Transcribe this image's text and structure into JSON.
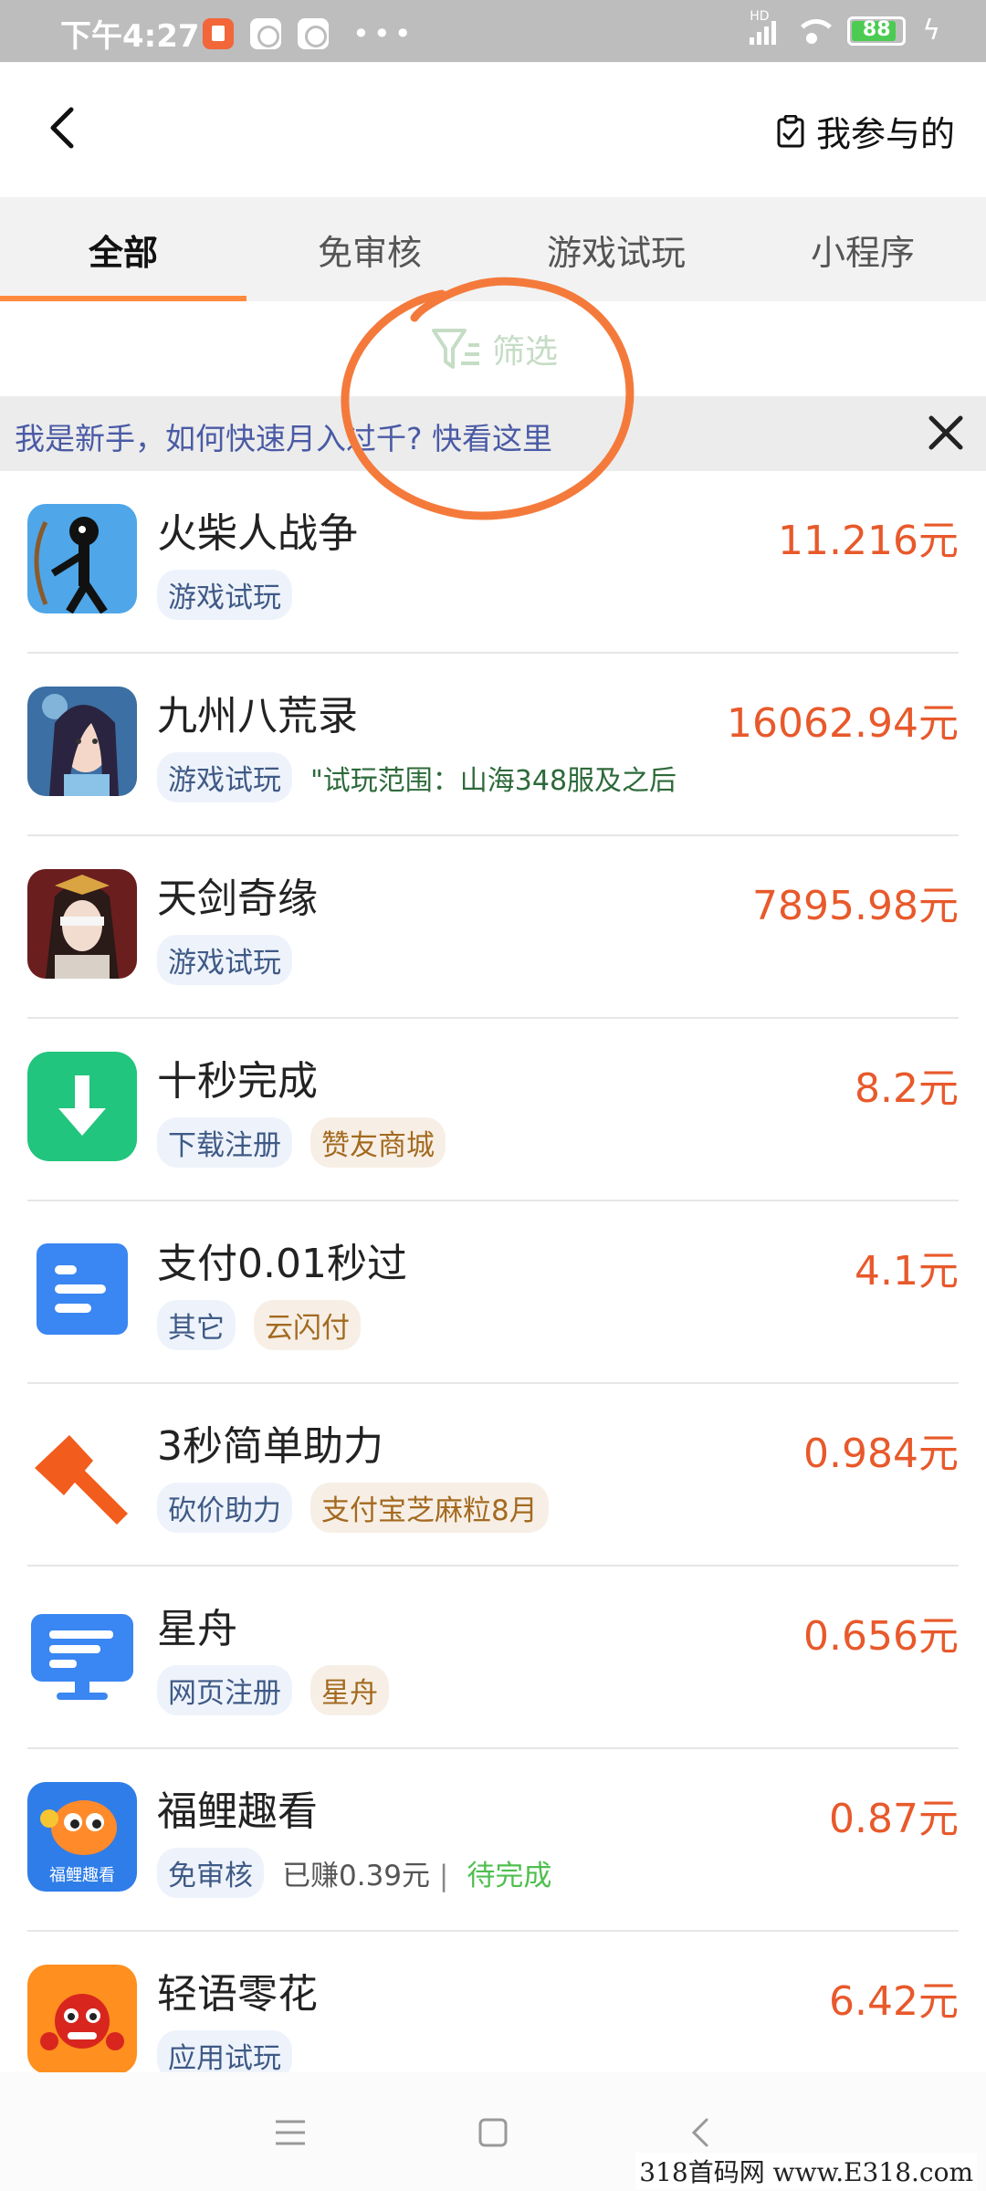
{
  "status_bar": {
    "time": "下午4:27",
    "battery_level": "88",
    "network_badge": "HD"
  },
  "header": {
    "mine_label": "我参与的"
  },
  "tabs": [
    {
      "label": "全部",
      "active": true
    },
    {
      "label": "免审核",
      "active": false
    },
    {
      "label": "游戏试玩",
      "active": false
    },
    {
      "label": "小程序",
      "active": false
    }
  ],
  "filter": {
    "label": "筛选"
  },
  "tip_banner": {
    "text": "我是新手，如何快速月入过千? 快看这里"
  },
  "tasks": [
    {
      "title": "火柴人战争",
      "price": "11.216元",
      "tags": [
        "游戏试玩"
      ],
      "icon": "stickman-bow-icon"
    },
    {
      "title": "九州八荒录",
      "price": "16062.94元",
      "tags": [
        "游戏试玩"
      ],
      "note": "\"试玩范围：山海348服及之后",
      "icon": "fantasy-girl-icon"
    },
    {
      "title": "天剑奇缘",
      "price": "7895.98元",
      "tags": [
        "游戏试玩"
      ],
      "icon": "blindfold-hero-icon"
    },
    {
      "title": "十秒完成",
      "price": "8.2元",
      "tags": [
        "下载注册",
        "赞友商城"
      ],
      "icon": "download-arrow-icon"
    },
    {
      "title": "支付0.01秒过",
      "price": "4.1元",
      "tags": [
        "其它",
        "云闪付"
      ],
      "icon": "document-lines-icon"
    },
    {
      "title": "3秒简单助力",
      "price": "0.984元",
      "tags": [
        "砍价助力",
        "支付宝芝麻粒8月"
      ],
      "icon": "axe-icon"
    },
    {
      "title": "星舟",
      "price": "0.656元",
      "tags": [
        "网页注册",
        "星舟"
      ],
      "icon": "monitor-icon"
    },
    {
      "title": "福鲤趣看",
      "price": "0.87元",
      "tags": [
        "免审核"
      ],
      "earned": "已赚0.39元",
      "separator": "|",
      "status": "待完成",
      "icon": "lucky-fish-icon",
      "icon_text": "福鲤趣看"
    },
    {
      "title": "轻语零花",
      "price": "6.42元",
      "tags": [
        "应用试玩"
      ],
      "icon": "lion-dance-icon"
    }
  ],
  "watermark": "318首码网 www.E318.com",
  "colors": {
    "accent_orange": "#ff8a3d",
    "price_red": "#e8592b",
    "tip_blue": "#4a5aa5",
    "tag_blue_text": "#3f5a86",
    "tag_brown_text": "#a36a1f",
    "pending_green": "#4fbf4f"
  }
}
